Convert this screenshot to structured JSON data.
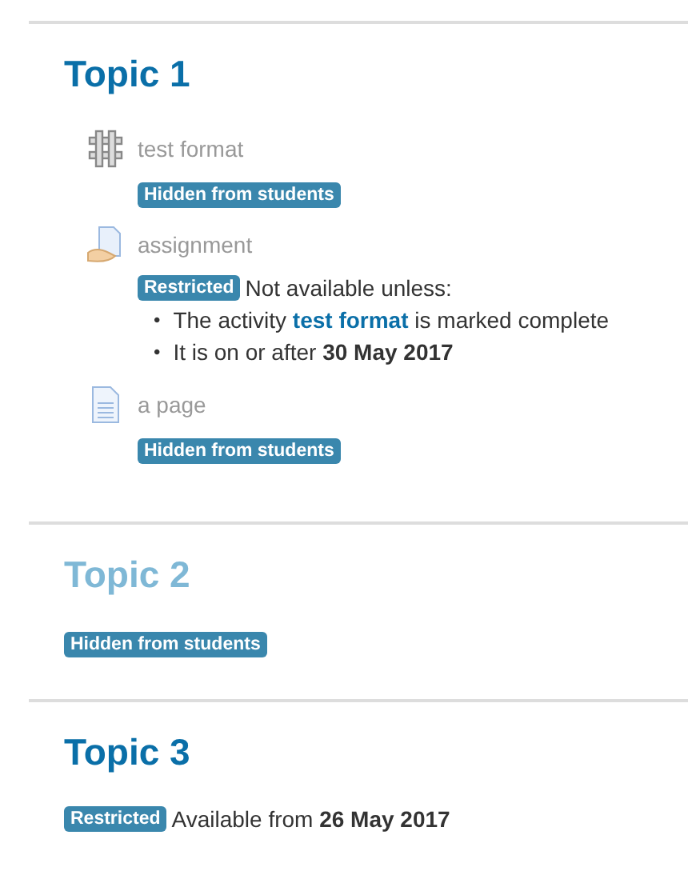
{
  "sections": [
    {
      "title": "Topic 1",
      "dimmed": false,
      "activities": [
        {
          "kind": "grid",
          "name": "test format",
          "dimmed": true,
          "badge": "Hidden from students"
        },
        {
          "kind": "assignment",
          "name": "assignment",
          "dimmed": true,
          "restriction": {
            "badge": "Restricted",
            "text": "Not available unless:",
            "conditions": [
              {
                "kind": "link",
                "bullet": "•",
                "before": "The activity ",
                "link": "test format",
                "after": " is marked complete"
              },
              {
                "kind": "text",
                "bullet": "•",
                "text": "It is on or after **30 May 2017**"
              }
            ]
          }
        },
        {
          "kind": "page",
          "name": "a page",
          "dimmed": true,
          "badge": "Hidden from students"
        }
      ]
    },
    {
      "title": "Topic 2",
      "dimmed": true,
      "badge": "Hidden from students"
    },
    {
      "title": "Topic 3",
      "dimmed": false,
      "restriction": {
        "badge": "Restricted",
        "text": "Available from **26 May 2017**"
      }
    }
  ]
}
